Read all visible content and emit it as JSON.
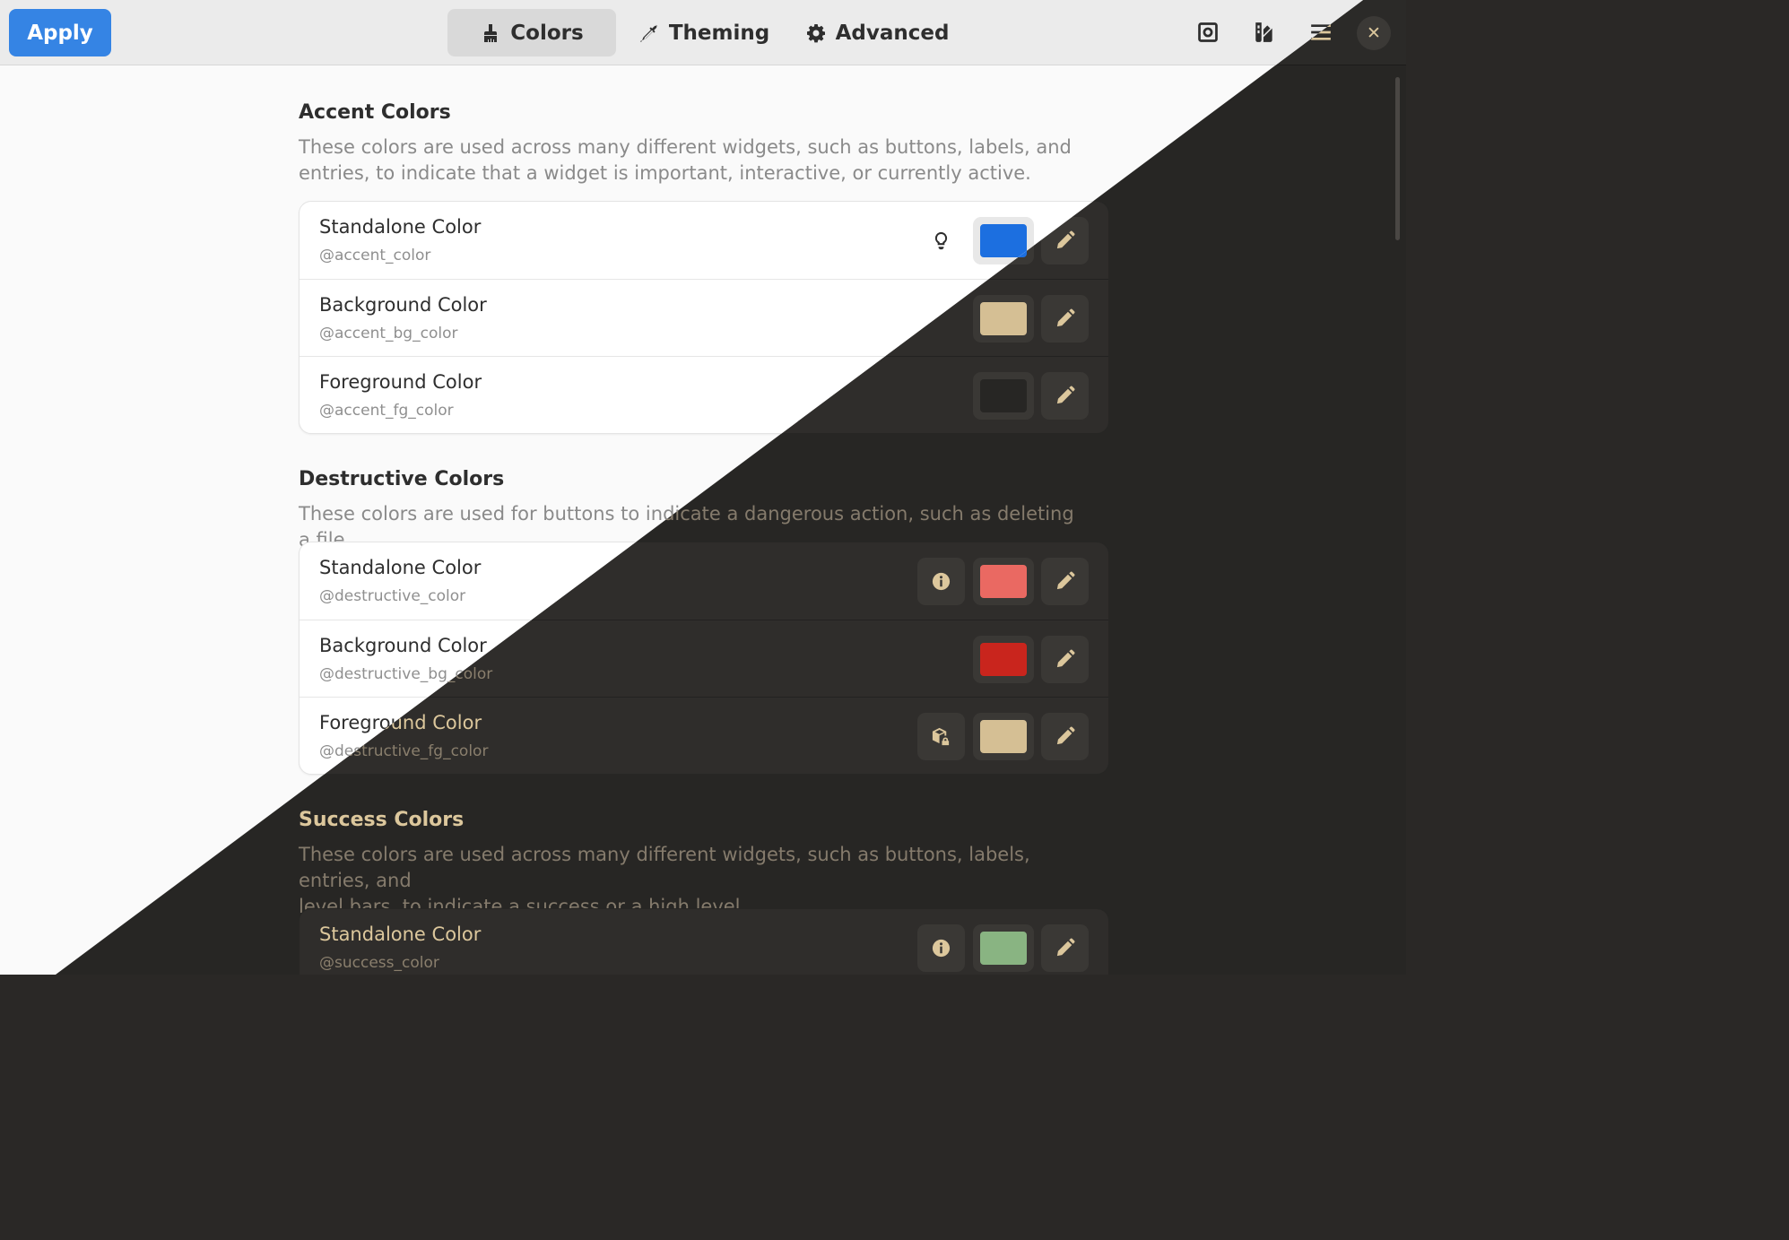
{
  "header": {
    "apply_label": "Apply",
    "tabs": [
      {
        "label": "Colors",
        "icon": "brush-icon",
        "active": true
      },
      {
        "label": "Theming",
        "icon": "eyedropper-icon",
        "active": false
      },
      {
        "label": "Advanced",
        "icon": "gear-icon",
        "active": false
      }
    ],
    "icons": [
      "screenshot-icon",
      "palette-icon",
      "hamburger-menu-icon"
    ],
    "close_label": "✕"
  },
  "sections": {
    "accent": {
      "title": "Accent Colors",
      "description_line1": "These colors are used across many different widgets, such as buttons, labels, and",
      "description_line2": "entries, to indicate that a widget is important, interactive, or currently active.",
      "rows": [
        {
          "title": "Standalone Color",
          "variable": "@accent_color",
          "color": "#1c6fe0",
          "extra_icon": "lightbulb-icon"
        },
        {
          "title": "Background Color",
          "variable": "@accent_bg_color",
          "color": "#d5bf94"
        },
        {
          "title": "Foreground Color",
          "variable": "@accent_fg_color",
          "color": "#272624"
        }
      ]
    },
    "destructive": {
      "title": "Destructive Colors",
      "description_line1": "These colors are used for buttons to indicate a dangerous action, such as deleting a file.",
      "rows": [
        {
          "title": "Standalone Color",
          "variable": "@destructive_color",
          "color": "#ea6962",
          "extra_icon": "info-icon"
        },
        {
          "title": "Background Color",
          "variable": "@destructive_bg_color",
          "color": "#c9251d"
        },
        {
          "title": "Foreground Color",
          "variable": "@destructive_fg_color",
          "color": "#d5bf94",
          "extra_icon": "package-lock-icon"
        }
      ]
    },
    "success": {
      "title": "Success Colors",
      "description_line1": "These colors are used across many different widgets, such as buttons, labels, entries, and",
      "description_line2": "level bars, to indicate a success or a high level.",
      "rows": [
        {
          "title": "Standalone Color",
          "variable": "@success_color",
          "color": "#89b482",
          "extra_icon": "info-icon"
        }
      ]
    }
  },
  "theme_colors": {
    "accent": "#3584e4",
    "dark_bg": "#272624",
    "dark_fg": "#dcc79c",
    "light_bg": "#fafafa"
  }
}
